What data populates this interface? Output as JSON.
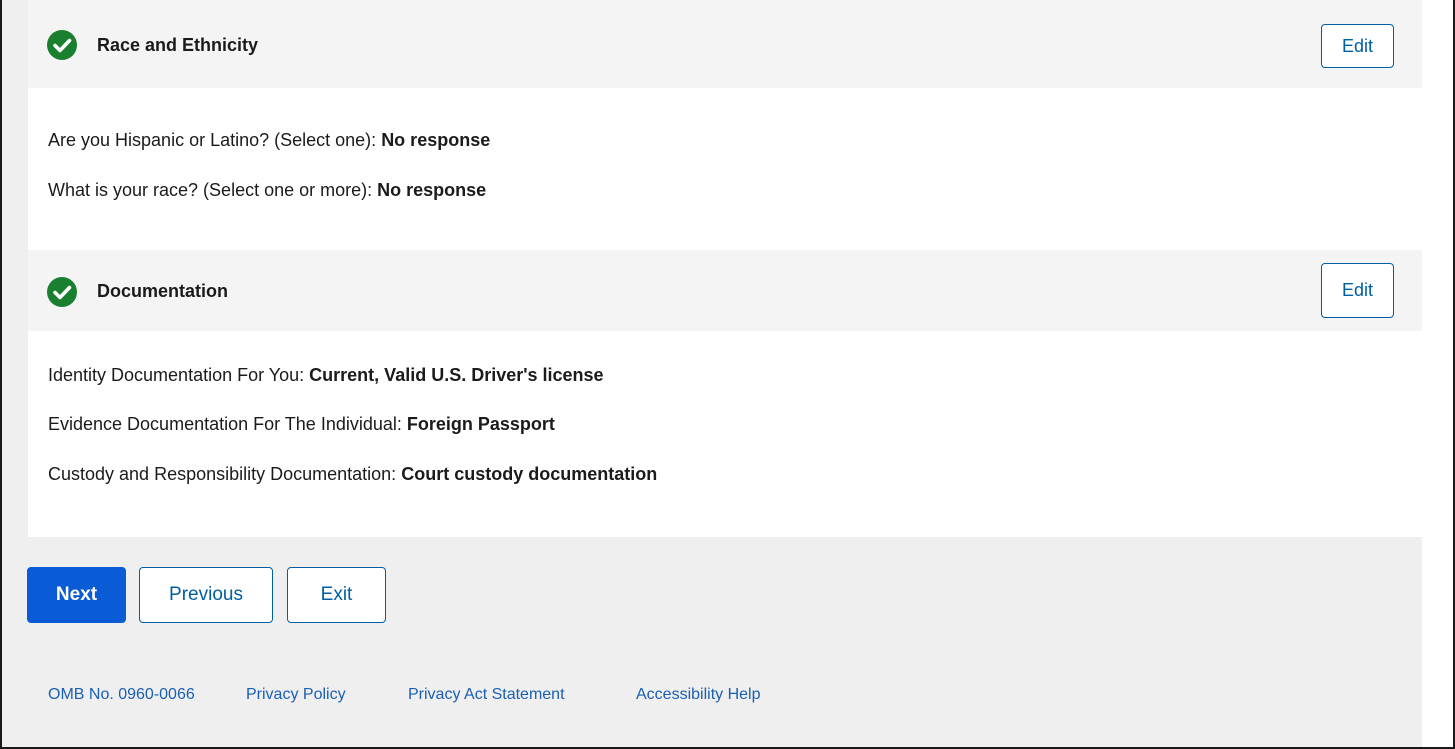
{
  "sections": [
    {
      "title": "Race and Ethnicity",
      "edit_label": "Edit",
      "rows": [
        {
          "label": "Are you Hispanic or Latino? (Select one): ",
          "value": "No response"
        },
        {
          "label": "What is your race? (Select one or more): ",
          "value": "No response"
        }
      ]
    },
    {
      "title": "Documentation",
      "edit_label": "Edit",
      "rows": [
        {
          "label": "Identity Documentation For You: ",
          "value": "Current, Valid U.S. Driver's license"
        },
        {
          "label": "Evidence Documentation For The Individual: ",
          "value": "Foreign Passport"
        },
        {
          "label": "Custody and Responsibility Documentation: ",
          "value": "Court custody documentation"
        }
      ]
    }
  ],
  "actions": {
    "next_label": "Next",
    "previous_label": "Previous",
    "exit_label": "Exit"
  },
  "footer": {
    "omb": "OMB No. 0960-0066",
    "privacy_policy": "Privacy Policy",
    "privacy_act": "Privacy Act Statement",
    "accessibility": "Accessibility Help"
  },
  "colors": {
    "success": "#1a7f2e",
    "primary": "#0a5cd6",
    "link": "#005ea2"
  },
  "icons": {
    "section_status": "check-circle-icon"
  }
}
